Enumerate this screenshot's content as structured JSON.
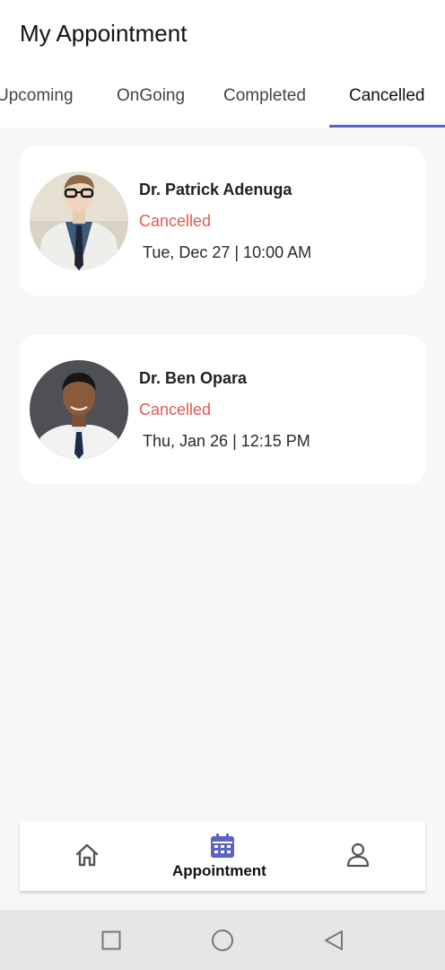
{
  "header": {
    "title": "My Appointment"
  },
  "tabs": [
    {
      "label": "Upcoming"
    },
    {
      "label": "OnGoing"
    },
    {
      "label": "Completed"
    },
    {
      "label": "Cancelled"
    }
  ],
  "appointments": [
    {
      "doctor": "Dr. Patrick Adenuga",
      "status": "Cancelled",
      "datetime": "Tue, Dec 27 | 10:00 AM"
    },
    {
      "doctor": "Dr. Ben Opara",
      "status": "Cancelled",
      "datetime": "Thu, Jan 26 | 12:15 PM"
    }
  ],
  "bottom_nav": {
    "items": [
      {
        "icon": "home-icon"
      },
      {
        "icon": "calendar-icon",
        "label": "Appointment"
      },
      {
        "icon": "person-icon"
      }
    ]
  },
  "system_nav": {
    "buttons": [
      "recents-square-icon",
      "home-circle-icon",
      "back-triangle-icon"
    ]
  },
  "colors": {
    "accent": "#5b63c7",
    "status_cancelled": "#e05a52",
    "background": "#f7f7f7"
  }
}
